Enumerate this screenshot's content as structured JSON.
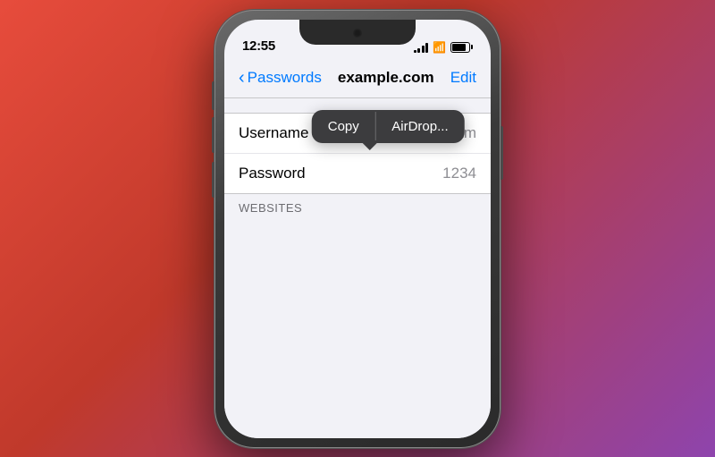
{
  "background": {
    "gradient_start": "#e74c3c",
    "gradient_end": "#8e44ad"
  },
  "status_bar": {
    "time": "12:55",
    "signal_bars": [
      3,
      5,
      8,
      11
    ],
    "battery_percent": 75
  },
  "nav": {
    "back_label": "Passwords",
    "title": "example.com",
    "edit_label": "Edit"
  },
  "context_menu": {
    "copy_label": "Copy",
    "airdrop_label": "AirDrop..."
  },
  "rows": [
    {
      "label": "Username",
      "value": "shivam"
    },
    {
      "label": "Password",
      "value": "1234"
    },
    {
      "label": "WEBSITES",
      "value": ""
    }
  ]
}
